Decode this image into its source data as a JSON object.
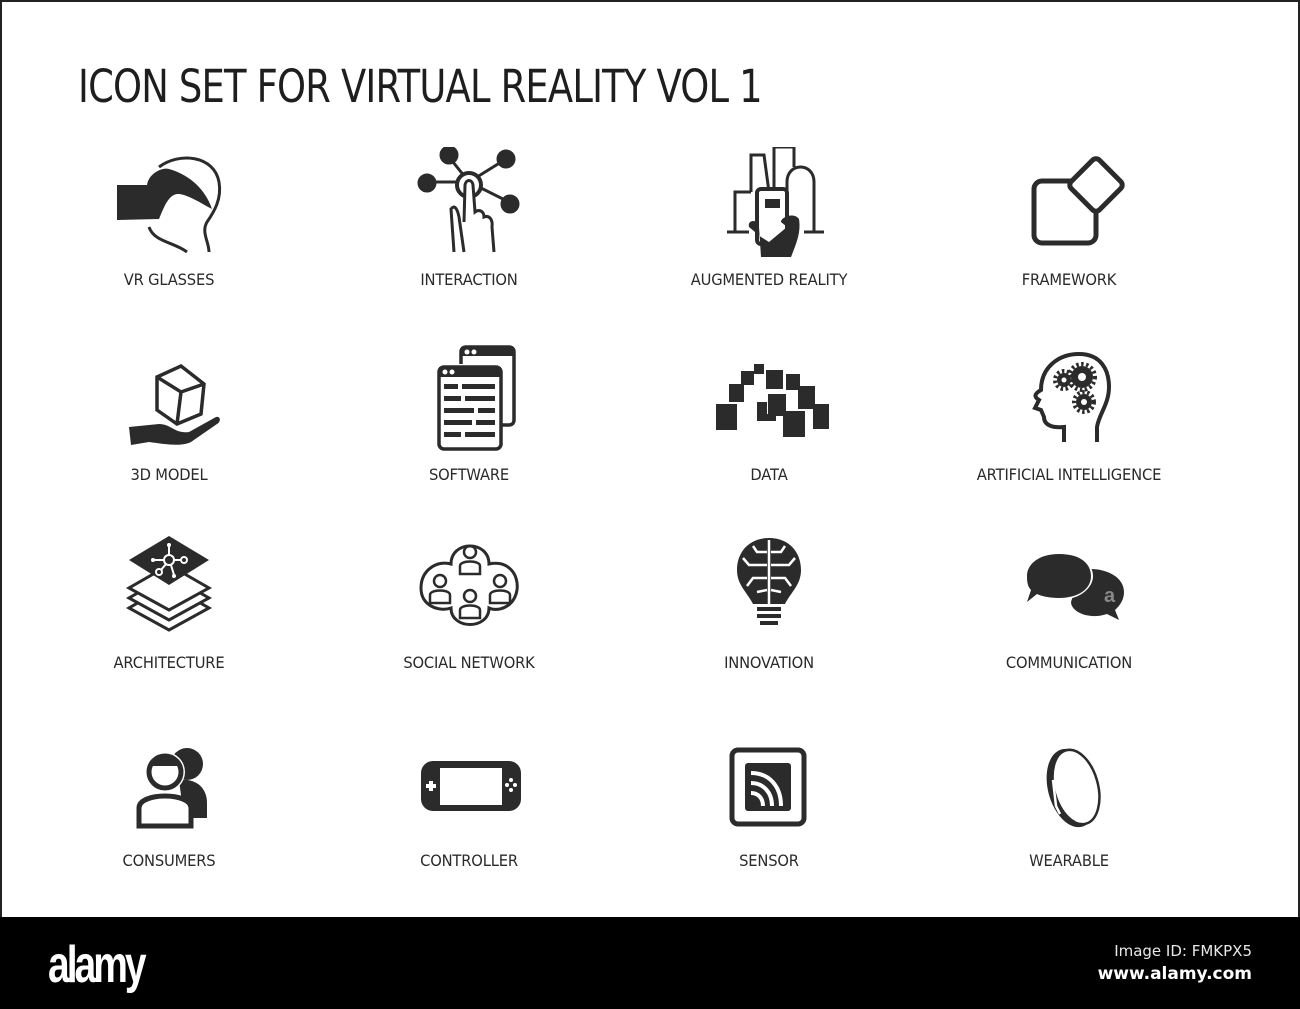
{
  "title": "ICON SET FOR VIRTUAL REALITY VOL 1",
  "icons": [
    {
      "label": "VR GLASSES",
      "icon": "vr-glasses-icon"
    },
    {
      "label": "INTERACTION",
      "icon": "interaction-icon"
    },
    {
      "label": "AUGMENTED REALITY",
      "icon": "augmented-reality-icon"
    },
    {
      "label": "FRAMEWORK",
      "icon": "framework-icon"
    },
    {
      "label": "3D MODEL",
      "icon": "3d-model-icon"
    },
    {
      "label": "SOFTWARE",
      "icon": "software-icon"
    },
    {
      "label": "DATA",
      "icon": "data-icon"
    },
    {
      "label": "ARTIFICIAL INTELLIGENCE",
      "icon": "artificial-intelligence-icon"
    },
    {
      "label": "ARCHITECTURE",
      "icon": "architecture-icon"
    },
    {
      "label": "SOCIAL NETWORK",
      "icon": "social-network-icon"
    },
    {
      "label": "INNOVATION",
      "icon": "innovation-icon"
    },
    {
      "label": "COMMUNICATION",
      "icon": "communication-icon"
    },
    {
      "label": "CONSUMERS",
      "icon": "consumers-icon"
    },
    {
      "label": "CONTROLLER",
      "icon": "controller-icon"
    },
    {
      "label": "SENSOR",
      "icon": "sensor-icon"
    },
    {
      "label": "WEARABLE",
      "icon": "wearable-icon"
    }
  ],
  "colors": {
    "icon": "#2b2b2b",
    "background": "#ffffff",
    "footer": "#000000"
  },
  "footer": {
    "logo": "alamy",
    "image_id": "Image ID: FMKPX5",
    "website": "www.alamy.com"
  }
}
